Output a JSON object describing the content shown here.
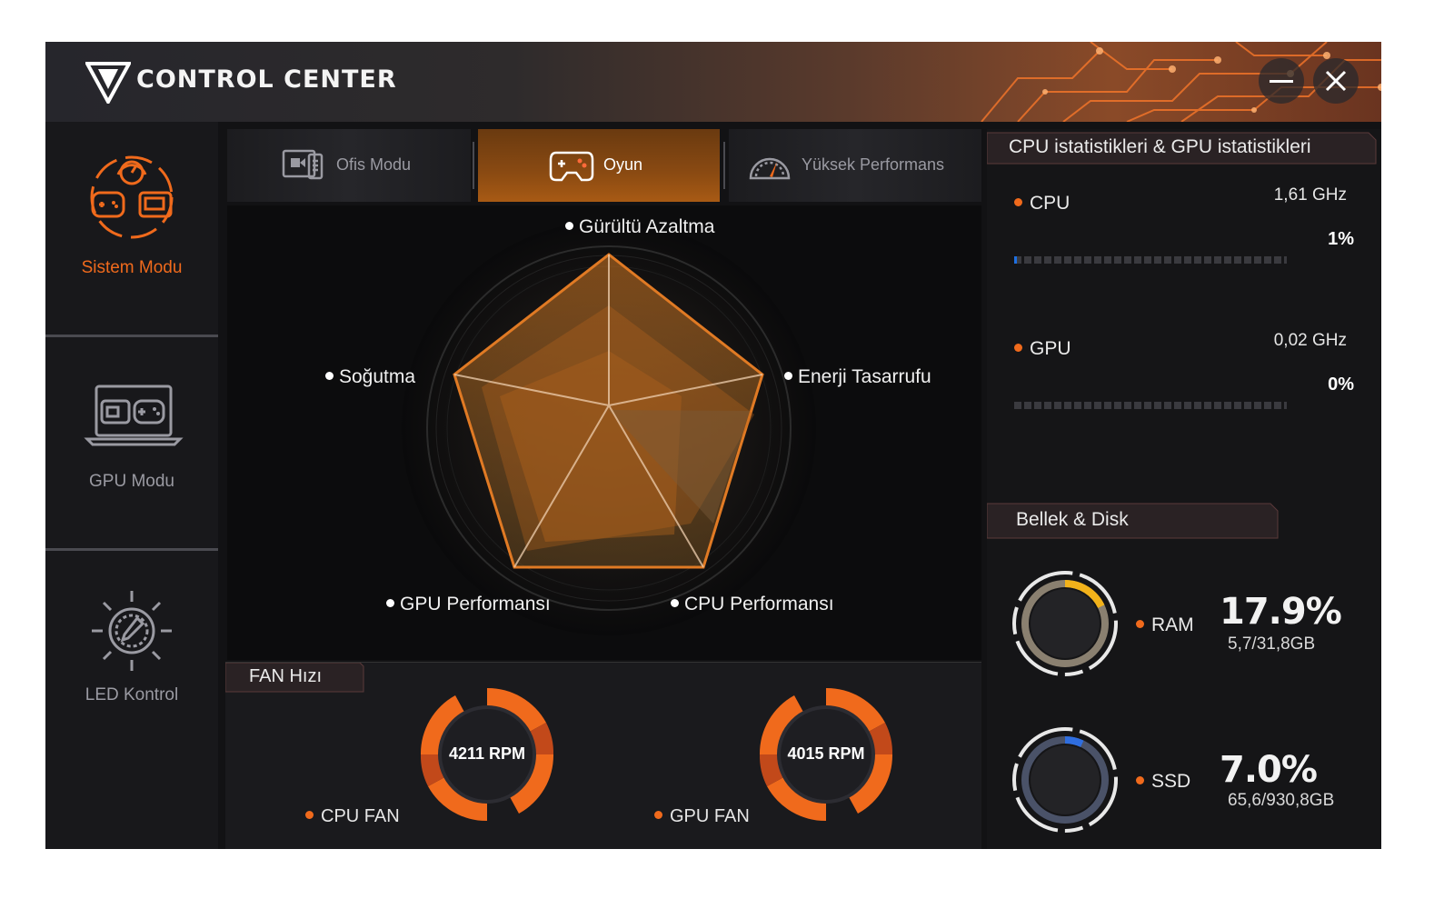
{
  "app": {
    "title": "CONTROL CENTER"
  },
  "window_controls": {
    "minimize": "—",
    "close": "✕"
  },
  "sidebar": {
    "items": [
      {
        "label": "Sistem Modu",
        "active": true,
        "icon": "system-mode-icon"
      },
      {
        "label": "GPU Modu",
        "active": false,
        "icon": "gpu-mode-icon"
      },
      {
        "label": "LED Kontrol",
        "active": false,
        "icon": "led-control-icon"
      }
    ]
  },
  "mode_tabs": [
    {
      "label": "Ofis Modu",
      "active": false,
      "icon": "office-icon"
    },
    {
      "label": "Oyun",
      "active": true,
      "icon": "gamepad-icon"
    },
    {
      "label": "Yüksek Performans",
      "active": false,
      "icon": "speedometer-icon"
    }
  ],
  "radar": {
    "axes": [
      "Gürültü Azaltma",
      "Enerji Tasarrufu",
      "CPU Performansı",
      "GPU Performansı",
      "Soğutma"
    ]
  },
  "fan": {
    "title": "FAN Hızı",
    "fans": [
      {
        "label": "CPU FAN",
        "rpm": "4211 RPM"
      },
      {
        "label": "GPU FAN",
        "rpm": "4015 RPM"
      }
    ]
  },
  "stats": {
    "title": "CPU istatistikleri & GPU istatistikleri",
    "cpu": {
      "label": "CPU",
      "freq": "1,61 GHz",
      "usage": "1%",
      "usage_value": 1
    },
    "gpu": {
      "label": "GPU",
      "freq": "0,02 GHz",
      "usage": "0%",
      "usage_value": 0
    }
  },
  "memory": {
    "title": "Bellek & Disk",
    "ram": {
      "label": "RAM",
      "percent": "17.9%",
      "size": "5,7/31,8GB",
      "value": 17.9
    },
    "ssd": {
      "label": "SSD",
      "percent": "7.0%",
      "size": "65,6/930,8GB",
      "value": 7.0
    }
  },
  "colors": {
    "accent": "#f06a1c",
    "bar": "#1e6fe0",
    "ram_ring": "#f2b21a",
    "ssd_ring": "#2f6ee0"
  }
}
